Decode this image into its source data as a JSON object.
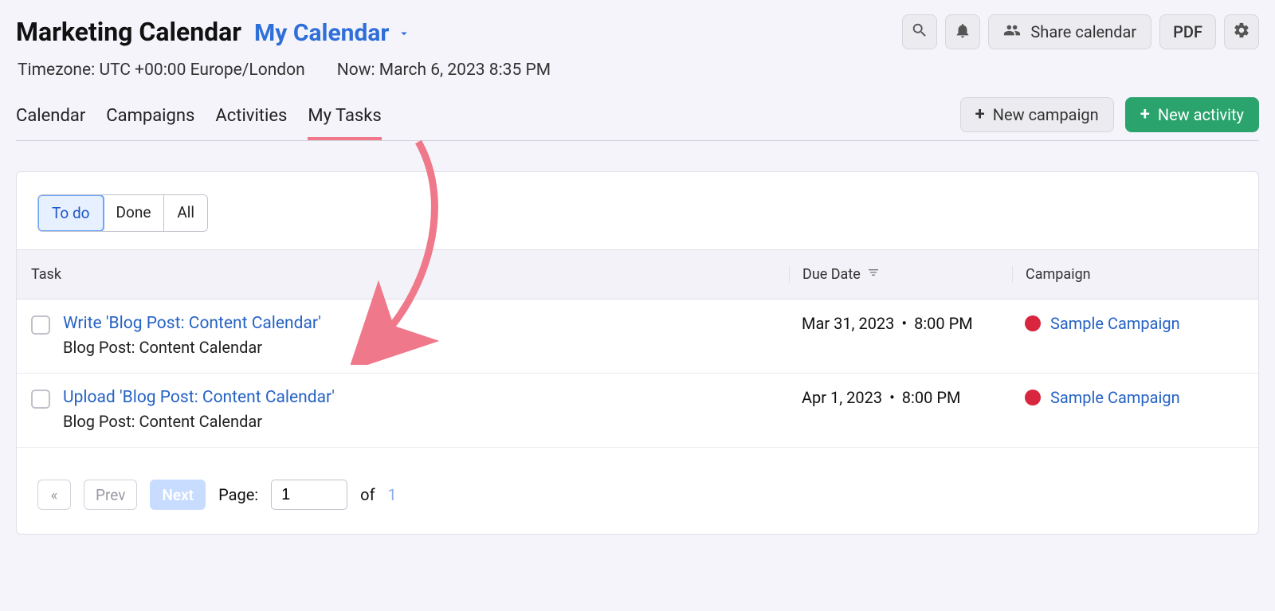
{
  "header": {
    "title": "Marketing Calendar",
    "calendar_name": "My Calendar",
    "share_label": "Share calendar",
    "pdf_label": "PDF"
  },
  "info": {
    "timezone": "Timezone: UTC +00:00 Europe/London",
    "now": "Now: March 6, 2023 8:35 PM"
  },
  "tabs": {
    "calendar": "Calendar",
    "campaigns": "Campaigns",
    "activities": "Activities",
    "my_tasks": "My Tasks"
  },
  "actions": {
    "new_campaign": "New campaign",
    "new_activity": "New activity"
  },
  "filters": {
    "todo": "To do",
    "done": "Done",
    "all": "All"
  },
  "columns": {
    "task": "Task",
    "due": "Due Date",
    "campaign": "Campaign"
  },
  "tasks": [
    {
      "title": "Write 'Blog Post: Content Calendar'",
      "subtitle": "Blog Post: Content Calendar",
      "due_date": "Mar 31, 2023",
      "due_time": "8:00 PM",
      "campaign": "Sample Campaign",
      "campaign_color": "#d7263d"
    },
    {
      "title": "Upload 'Blog Post: Content Calendar'",
      "subtitle": "Blog Post: Content Calendar",
      "due_date": "Apr 1, 2023",
      "due_time": "8:00 PM",
      "campaign": "Sample Campaign",
      "campaign_color": "#d7263d"
    }
  ],
  "pagination": {
    "prev": "Prev",
    "next": "Next",
    "page_label": "Page:",
    "page_value": "1",
    "of_label": "of",
    "total": "1"
  }
}
